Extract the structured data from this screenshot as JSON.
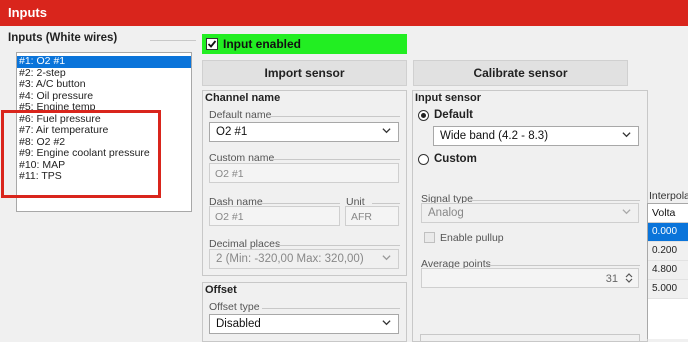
{
  "window": {
    "title": "Inputs"
  },
  "inputs_list": {
    "group_label": "Inputs (White wires)",
    "items": [
      "#1: O2 #1",
      "#2: 2-step",
      "#3: A/C button",
      "#4: Oil pressure",
      "#5: Engine temp",
      "#6: Fuel pressure",
      "#7: Air temperature",
      "#8: O2 #2",
      "#9: Engine coolant pressure",
      "#10: MAP",
      "#11: TPS"
    ],
    "selected_index": 0
  },
  "input_enabled": {
    "label": "Input enabled",
    "checked": true
  },
  "buttons": {
    "import_sensor": "Import sensor",
    "calibrate_sensor": "Calibrate sensor"
  },
  "channel": {
    "title": "Channel name",
    "default_name_label": "Default name",
    "default_name_value": "O2 #1",
    "custom_name_label": "Custom name",
    "custom_name_placeholder": "O2 #1",
    "dash_name_label": "Dash name",
    "dash_name_placeholder": "O2 #1",
    "unit_label": "Unit",
    "unit_placeholder": "AFR",
    "decimal_places_label": "Decimal places",
    "decimal_places_value": "2 (Min: -320,00 Max: 320,00)"
  },
  "offset": {
    "title": "Offset",
    "type_label": "Offset type",
    "type_value": "Disabled"
  },
  "input_sensor": {
    "title": "Input sensor",
    "default_label": "Default",
    "default_selected": true,
    "sensor_value": "Wide band (4.2 - 8.3)",
    "custom_label": "Custom",
    "signal_type_label": "Signal type",
    "signal_type_value": "Analog",
    "enable_pullup_label": "Enable pullup",
    "average_points_label": "Average points",
    "average_points_value": "31"
  },
  "interpolation": {
    "title": "Interpola",
    "header": "Volta",
    "rows": [
      "0.000",
      "0.200",
      "4.800",
      "5.000"
    ],
    "selected_row": 0
  },
  "colors": {
    "title_bar": "#d9251c",
    "highlight_box": "#d9251c",
    "enabled_green": "#22ee22",
    "selection_blue": "#0a74da"
  }
}
